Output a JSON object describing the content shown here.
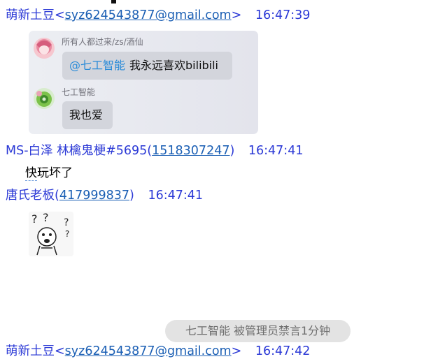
{
  "messages": [
    {
      "sender": "萌新土豆",
      "contact_prefix": "<",
      "contact": "syz624543877@gmail.com",
      "contact_suffix": ">",
      "time": "16:47:39",
      "quoted": [
        {
          "author": "所有人都过来/zs/酒仙",
          "mention": "@七工智能",
          "text": "我永远喜欢bilibili"
        },
        {
          "author": "七工智能",
          "text": "我也爱"
        }
      ]
    },
    {
      "sender": "MS-白泽 林檎鬼梗#5695",
      "contact_prefix": "(",
      "contact": "1518307247",
      "contact_suffix": ")",
      "time": "16:47:41",
      "text_marked": "快",
      "text_rest": "玩坏了"
    },
    {
      "sender": "唐氏老板",
      "contact_prefix": "(",
      "contact": "417999837",
      "contact_suffix": ")",
      "time": "16:47:41",
      "sticker": "confused-face-sticker"
    }
  ],
  "system_notice": "七工智能 被管理员禁言1分钟",
  "partial_next": {
    "sender": "萌新土豆",
    "contact_prefix": "<",
    "contact": "syz624543877@gmail.com",
    "contact_suffix": ">",
    "time": "16:47:42"
  }
}
